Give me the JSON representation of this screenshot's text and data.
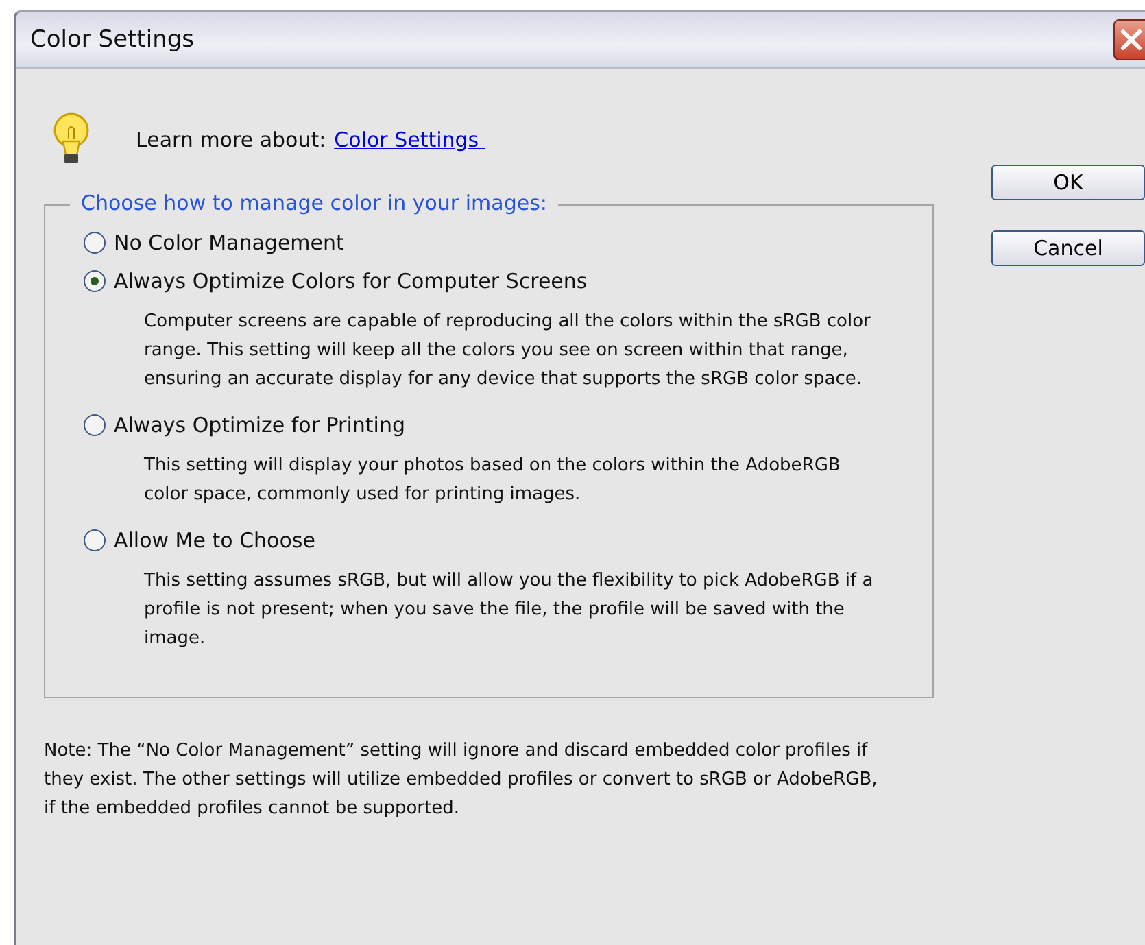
{
  "window": {
    "title": "Color Settings"
  },
  "learn_more": {
    "label": "Learn more about:",
    "link": "Color Settings "
  },
  "group": {
    "legend": "Choose how to manage color in your images:",
    "options": [
      {
        "label": "No Color Management",
        "selected": false
      },
      {
        "label": "Always Optimize Colors for Computer Screens",
        "selected": true,
        "description": "Computer screens are capable of reproducing all the colors within the sRGB color range. This setting will keep all the colors you see on screen within that range, ensuring an accurate display for any device that supports the sRGB color space."
      },
      {
        "label": "Always Optimize for Printing",
        "selected": false,
        "description": "This setting will display your photos based on the colors within the AdobeRGB color space, commonly used for printing images."
      },
      {
        "label": "Allow Me to Choose",
        "selected": false,
        "description": "This setting assumes sRGB, but will allow you the flexibility to pick AdobeRGB if a profile is not present; when you save the file, the profile will be saved with the image."
      }
    ]
  },
  "note": "Note: The “No Color Management” setting will ignore and discard embedded color profiles if they exist. The other settings will utilize embedded profiles or convert to sRGB or AdobeRGB, if the embedded profiles cannot be supported.",
  "buttons": [
    "OK",
    "Cancel"
  ]
}
